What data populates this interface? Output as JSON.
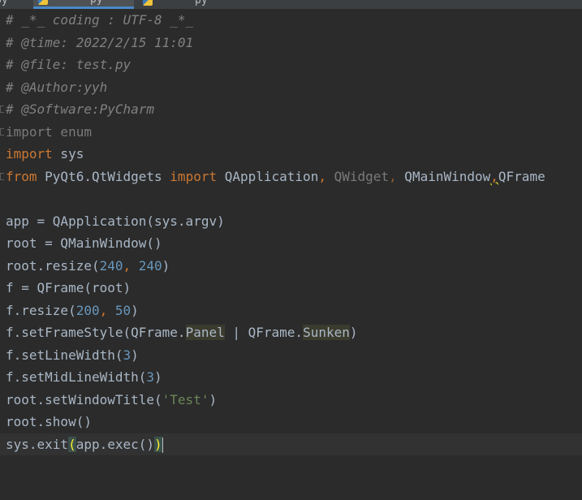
{
  "tabs": [
    {
      "label": "py",
      "active": false
    },
    {
      "label": "py",
      "active": true
    },
    {
      "label": "py",
      "active": false
    }
  ],
  "code": {
    "l1": "# _*_ coding : UTF-8 _*_",
    "l2": "# @time: 2022/2/15 11:01",
    "l3": "# @file: test.py",
    "l4": "# @Author:yyh",
    "l5": "# @Software:PyCharm",
    "l6_kw": "import",
    "l6_mod": " enum",
    "l7_kw": "import",
    "l7_mod": " sys",
    "l8_from": "from",
    "l8_mod": " PyQt6.QtWidgets ",
    "l8_import": "import",
    "l8_n1": " QApplication",
    "l8_c1": ",",
    "l8_n2": " QWidget",
    "l8_c2": ",",
    "l8_n3": " QMainWindow",
    "l8_c3": ",",
    "l8_n4": "QFrame",
    "l10": "app = QApplication(sys.argv)",
    "l11": "root = QMainWindow()",
    "l12_a": "root.resize(",
    "l12_n1": "240",
    "l12_c": ", ",
    "l12_n2": "240",
    "l12_b": ")",
    "l13": "f = QFrame(root)",
    "l14_a": "f.resize(",
    "l14_n1": "200",
    "l14_c": ", ",
    "l14_n2": "50",
    "l14_b": ")",
    "l15_a": "f.setFrameStyle(QFrame.",
    "l15_panel": "Panel",
    "l15_mid": " | QFrame.",
    "l15_sunken": "Sunken",
    "l15_b": ")",
    "l16_a": "f.setLineWidth(",
    "l16_n": "3",
    "l16_b": ")",
    "l17_a": "f.setMidLineWidth(",
    "l17_n": "3",
    "l17_b": ")",
    "l18_a": "root.setWindowTitle(",
    "l18_s": "'Test'",
    "l18_b": ")",
    "l19": "root.show()",
    "l20_a": "sys.exit",
    "l20_p1": "(",
    "l20_mid": "app.exec()",
    "l20_p2": ")"
  },
  "colors": {
    "background": "#2b2b2b",
    "keyword": "#cc7832",
    "comment": "#808080",
    "number": "#6897bb",
    "string": "#6a8759",
    "identifier": "#a9b7c6"
  }
}
